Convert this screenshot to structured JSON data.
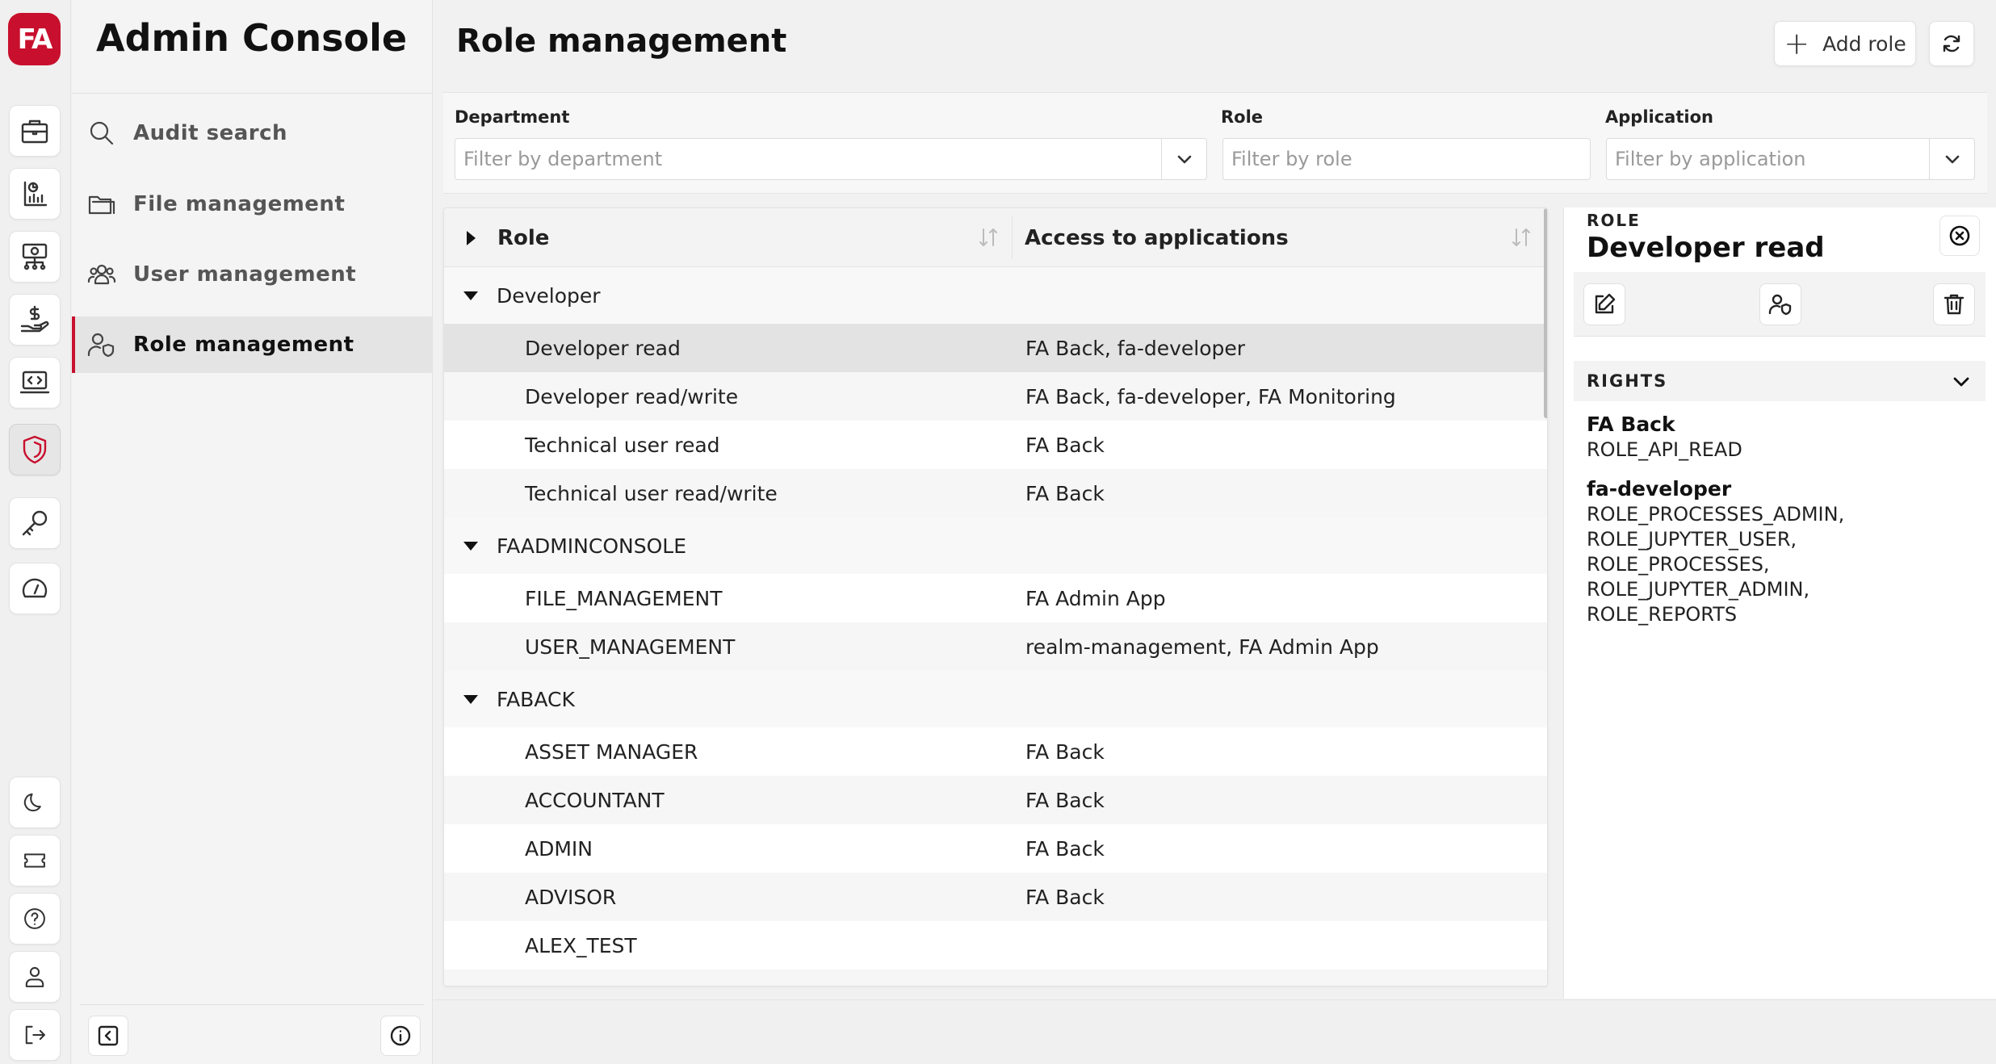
{
  "brand": {
    "logo_text": "FA",
    "accent": "#c8102e"
  },
  "rail": {
    "items": [
      {
        "name": "portfolio-icon"
      },
      {
        "name": "reports-icon"
      },
      {
        "name": "network-icon"
      },
      {
        "name": "finance-icon"
      },
      {
        "name": "developer-icon"
      },
      {
        "name": "admin-shield-icon",
        "active": true
      },
      {
        "name": "key-icon"
      },
      {
        "name": "dashboard-icon"
      }
    ],
    "bottom": [
      "moon-icon",
      "ticket-icon",
      "help-icon",
      "user-icon",
      "logout-icon"
    ]
  },
  "nav": {
    "title": "Admin Console",
    "items": [
      {
        "label": "Audit search",
        "icon": "search-icon"
      },
      {
        "label": "File management",
        "icon": "folder-icon"
      },
      {
        "label": "User management",
        "icon": "users-icon"
      },
      {
        "label": "Role management",
        "icon": "user-shield-icon",
        "active": true
      }
    ]
  },
  "header": {
    "title": "Role management",
    "add_label": "Add role"
  },
  "filters": {
    "department": {
      "label": "Department",
      "placeholder": "Filter by department"
    },
    "role": {
      "label": "Role",
      "placeholder": "Filter by role"
    },
    "application": {
      "label": "Application",
      "placeholder": "Filter by application"
    }
  },
  "table": {
    "columns": [
      "Role",
      "Access to applications"
    ],
    "rows": [
      {
        "type": "group",
        "label": "Developer"
      },
      {
        "type": "item",
        "role": "Developer read",
        "apps": "FA Back, fa-developer",
        "selected": true
      },
      {
        "type": "item",
        "role": "Developer read/write",
        "apps": "FA Back, fa-developer, FA Monitoring"
      },
      {
        "type": "item",
        "role": "Technical user read",
        "apps": "FA Back"
      },
      {
        "type": "item",
        "role": "Technical user read/write",
        "apps": "FA Back"
      },
      {
        "type": "group",
        "label": "FAADMINCONSOLE"
      },
      {
        "type": "item",
        "role": "FILE_MANAGEMENT",
        "apps": "FA Admin App"
      },
      {
        "type": "item",
        "role": "USER_MANAGEMENT",
        "apps": "realm-management, FA Admin App"
      },
      {
        "type": "group",
        "label": "FABACK"
      },
      {
        "type": "item",
        "role": "ASSET MANAGER",
        "apps": "FA Back"
      },
      {
        "type": "item",
        "role": "ACCOUNTANT",
        "apps": "FA Back"
      },
      {
        "type": "item",
        "role": "ADMIN",
        "apps": "FA Back"
      },
      {
        "type": "item",
        "role": "ADVISOR",
        "apps": "FA Back"
      },
      {
        "type": "item",
        "role": "ALEX_TEST",
        "apps": ""
      }
    ]
  },
  "detail": {
    "label": "ROLE",
    "title": "Developer read",
    "rights_label": "RIGHTS",
    "rights": [
      {
        "app": "FA Back",
        "roles": [
          "ROLE_API_READ"
        ]
      },
      {
        "app": "fa-developer",
        "roles": [
          "ROLE_PROCESSES_ADMIN,",
          "ROLE_JUPYTER_USER,",
          "ROLE_PROCESSES,",
          "ROLE_JUPYTER_ADMIN,",
          "ROLE_REPORTS"
        ]
      }
    ]
  }
}
